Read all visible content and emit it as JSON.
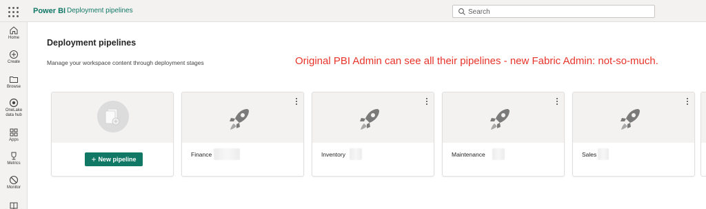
{
  "header": {
    "app_name": "Power BI",
    "breadcrumb": "Deployment pipelines",
    "search_placeholder": "Search"
  },
  "rail": {
    "items": [
      {
        "label": "Home",
        "icon": "home-icon"
      },
      {
        "label": "Create",
        "icon": "plus-circle-icon"
      },
      {
        "label": "Browse",
        "icon": "folder-icon"
      },
      {
        "label_line1": "OneLake",
        "label_line2": "data hub",
        "icon": "onelake-icon"
      },
      {
        "label": "Apps",
        "icon": "apps-icon"
      },
      {
        "label": "Metrics",
        "icon": "trophy-icon"
      },
      {
        "label": "Monitor",
        "icon": "monitor-icon"
      },
      {
        "label": "",
        "icon": "book-icon"
      }
    ]
  },
  "main": {
    "title": "Deployment pipelines",
    "subtitle": "Manage your workspace content through deployment stages",
    "annotation": "Original PBI Admin can see all their pipelines - new Fabric Admin: not-so-much.",
    "annotation_color": "#e8332a",
    "new_pipeline_label": "New pipeline",
    "pipelines": [
      {
        "name": "Finance"
      },
      {
        "name": "Inventory"
      },
      {
        "name": "Maintenance"
      },
      {
        "name": "Sales"
      }
    ]
  },
  "colors": {
    "accent": "#117865",
    "rail_bg": "#f3f2f1"
  }
}
